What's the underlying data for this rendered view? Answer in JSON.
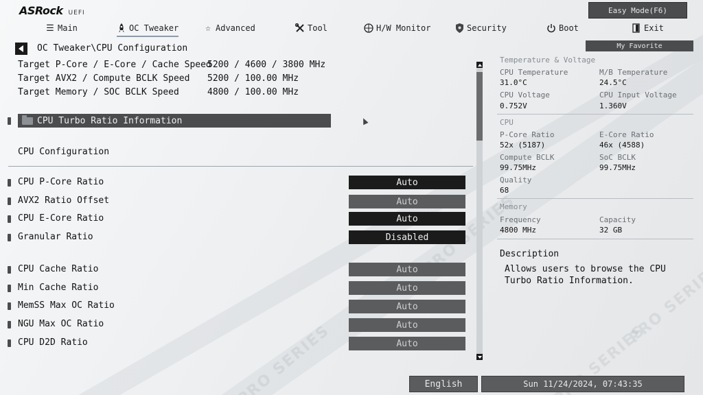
{
  "brand": {
    "name": "ASRock",
    "suffix": "UEFI"
  },
  "easy_mode_label": "Easy Mode(F6)",
  "my_favorite_label": "My Favorite",
  "nav": [
    {
      "label": "Main",
      "icon": "list-icon"
    },
    {
      "label": "OC Tweaker",
      "icon": "rocket-icon",
      "active": true
    },
    {
      "label": "Advanced",
      "icon": "star-icon"
    },
    {
      "label": "Tool",
      "icon": "wrench-icon"
    },
    {
      "label": "H/W Monitor",
      "icon": "crosshair-icon"
    },
    {
      "label": "Security",
      "icon": "shield-icon"
    },
    {
      "label": "Boot",
      "icon": "power-icon"
    },
    {
      "label": "Exit",
      "icon": "exit-icon"
    }
  ],
  "breadcrumb": "OC Tweaker\\CPU Configuration",
  "targets": [
    {
      "label": "Target P-Core / E-Core / Cache Speed",
      "value": "5200 / 4600 / 3800 MHz"
    },
    {
      "label": "Target AVX2 / Compute BCLK Speed",
      "value": "5200 / 100.00 MHz"
    },
    {
      "label": "Target Memory / SOC BCLK Speed",
      "value": "4800 / 100.00 MHz"
    }
  ],
  "turbo_info_label": "CPU Turbo Ratio Information",
  "section_title": "CPU Configuration",
  "options": [
    {
      "label": "CPU P-Core Ratio",
      "value": "Auto",
      "style": "dark"
    },
    {
      "label": "AVX2 Ratio Offset",
      "value": "Auto",
      "style": "gray"
    },
    {
      "label": "CPU E-Core Ratio",
      "value": "Auto",
      "style": "dark"
    },
    {
      "label": "Granular Ratio",
      "value": "Disabled",
      "style": "dark"
    },
    {
      "label": "CPU Cache  Ratio",
      "value": "Auto",
      "style": "gray"
    },
    {
      "label": "Min Cache  Ratio",
      "value": "Auto",
      "style": "gray"
    },
    {
      "label": "MemSS Max OC Ratio",
      "value": "Auto",
      "style": "gray"
    },
    {
      "label": "NGU Max OC Ratio",
      "value": "Auto",
      "style": "gray"
    },
    {
      "label": "CPU D2D Ratio",
      "value": "Auto",
      "style": "gray"
    }
  ],
  "monitor": {
    "temp_voltage_head": "Temperature & Voltage",
    "cpu_temp_label": "CPU Temperature",
    "cpu_temp": "31.0°C",
    "mb_temp_label": "M/B Temperature",
    "mb_temp": "24.5°C",
    "cpu_voltage_label": "CPU Voltage",
    "cpu_voltage": "0.752V",
    "cpu_input_voltage_label": "CPU Input Voltage",
    "cpu_input_voltage": "1.360V",
    "cpu_head": "CPU",
    "pcore_ratio_label": "P-Core Ratio",
    "pcore_ratio": "52x (5187)",
    "ecore_ratio_label": "E-Core Ratio",
    "ecore_ratio": "46x (4588)",
    "compute_bclk_label": "Compute BCLK",
    "compute_bclk": "99.75MHz",
    "soc_bclk_label": "SoC BCLK",
    "soc_bclk": "99.75MHz",
    "quality_label": "Quality",
    "quality": "68",
    "memory_head": "Memory",
    "frequency_label": "Frequency",
    "frequency": "4800 MHz",
    "capacity_label": "Capacity",
    "capacity": "32 GB"
  },
  "description": {
    "title": "Description",
    "text": "Allows users to browse the CPU Turbo Ratio Information."
  },
  "language": "English",
  "datetime": "Sun 11/24/2024, 07:43:35"
}
